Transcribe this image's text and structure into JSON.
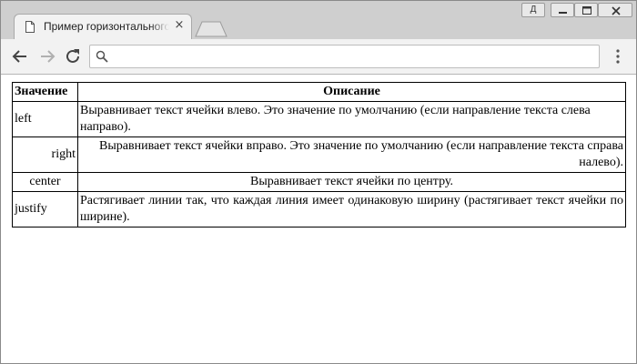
{
  "browser": {
    "tab_title": "Пример горизонтального выравнивания",
    "tab_close": "×",
    "user_button": "Д",
    "address": ""
  },
  "table": {
    "headers": [
      "Значение",
      "Описание"
    ],
    "rows": [
      {
        "value": "left",
        "description": "Выравнивает текст ячейки влево. Это значение по умолчанию (если направление текста слева направо).",
        "align": "left"
      },
      {
        "value": "right",
        "description": "Выравнивает текст ячейки вправо. Это значение по умолчанию (если направление текста справа налево).",
        "align": "right"
      },
      {
        "value": "center",
        "description": "Выравнивает текст ячейки по центру.",
        "align": "center"
      },
      {
        "value": "justify",
        "description": "Растягивает линии так, что каждая линия имеет одинаковую ширину (растягивает текст ячейки по ширине).",
        "align": "justify"
      }
    ]
  }
}
